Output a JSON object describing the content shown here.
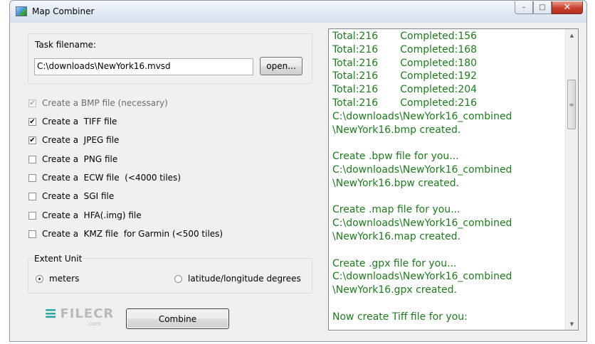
{
  "window": {
    "title": "Map Combiner",
    "close_glyph": "✕",
    "minimize_glyph": "–",
    "maximize_glyph": "□"
  },
  "task": {
    "label": "Task filename:",
    "value": "C:\\downloads\\NewYork16.mvsd",
    "open_label": "open..."
  },
  "options": [
    {
      "label": "Create a BMP file (necessary)",
      "checked": true,
      "disabled": true
    },
    {
      "label": "Create a  TIFF file",
      "checked": true,
      "disabled": false
    },
    {
      "label": "Create a  JPEG file",
      "checked": true,
      "disabled": false
    },
    {
      "label": "Create a  PNG file",
      "checked": false,
      "disabled": false
    },
    {
      "label": "Create a  ECW file  (<4000 tiles)",
      "checked": false,
      "disabled": false
    },
    {
      "label": "Create a  SGI file",
      "checked": false,
      "disabled": false
    },
    {
      "label": "Create a  HFA(.img) file",
      "checked": false,
      "disabled": false
    },
    {
      "label": "Create a  KMZ file  for Garmin (<500 tiles)",
      "checked": false,
      "disabled": false
    }
  ],
  "extent": {
    "label": "Extent Unit",
    "meters_label": "meters",
    "latlon_label": "latitude/longitude degrees",
    "selected": "meters"
  },
  "combine_label": "Combine",
  "watermark": {
    "text": "FILECR",
    "sub": ".com"
  },
  "log": [
    "Total:216       Completed:156",
    "Total:216       Completed:168",
    "Total:216       Completed:180",
    "Total:216       Completed:192",
    "Total:216       Completed:204",
    "Total:216       Completed:216",
    "C:\\downloads\\NewYork16_combined",
    "\\NewYork16.bmp created.",
    "",
    "Create .bpw file for you...",
    "C:\\downloads\\NewYork16_combined",
    "\\NewYork16.bpw created.",
    "",
    "Create .map file for you...",
    "C:\\downloads\\NewYork16_combined",
    "\\NewYork16.map created.",
    "",
    "Create .gpx file for you...",
    "C:\\downloads\\NewYork16_combined",
    "\\NewYork16.gpx created.",
    "",
    "Now create Tiff file for you:"
  ],
  "colors": {
    "log_text": "#1f7a1f",
    "window_bg": "#f0f0f0"
  }
}
